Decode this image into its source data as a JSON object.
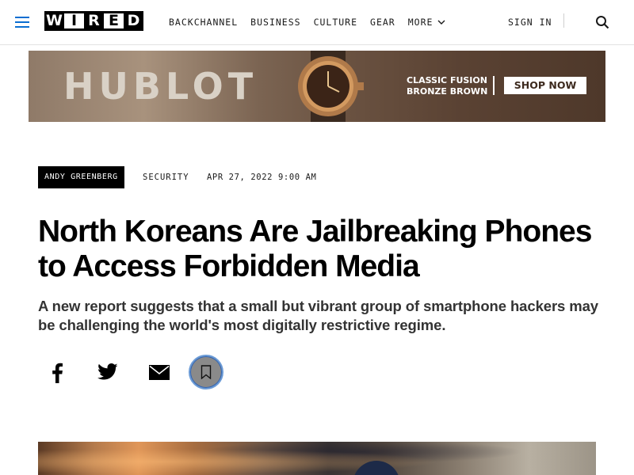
{
  "header": {
    "logo_letters": [
      "W",
      "I",
      "R",
      "E",
      "D"
    ],
    "nav": [
      {
        "label": "BACKCHANNEL"
      },
      {
        "label": "BUSINESS"
      },
      {
        "label": "CULTURE"
      },
      {
        "label": "GEAR"
      },
      {
        "label": "MORE"
      }
    ],
    "sign_in": "SIGN IN",
    "icons": {
      "menu": "hamburger-menu-icon",
      "search": "search-icon",
      "more": "chevron-down-icon"
    },
    "accent_color": "#0a6ed1"
  },
  "ad": {
    "brand": "HUBLOT",
    "tagline": "CLASSIC FUSION BRONZE BROWN",
    "cta": "SHOP NOW"
  },
  "article": {
    "author": "ANDY GREENBERG",
    "category": "SECURITY",
    "date": "APR 27, 2022 9:00 AM",
    "headline": "North Koreans Are Jailbreaking Phones to Access Forbidden Media",
    "dek": "A new report suggests that a small but vibrant group of smartphone hackers may be challenging the world's most digitally restrictive regime.",
    "share": [
      {
        "icon": "facebook-icon"
      },
      {
        "icon": "twitter-icon"
      },
      {
        "icon": "email-icon"
      },
      {
        "icon": "bookmark-icon"
      }
    ]
  }
}
